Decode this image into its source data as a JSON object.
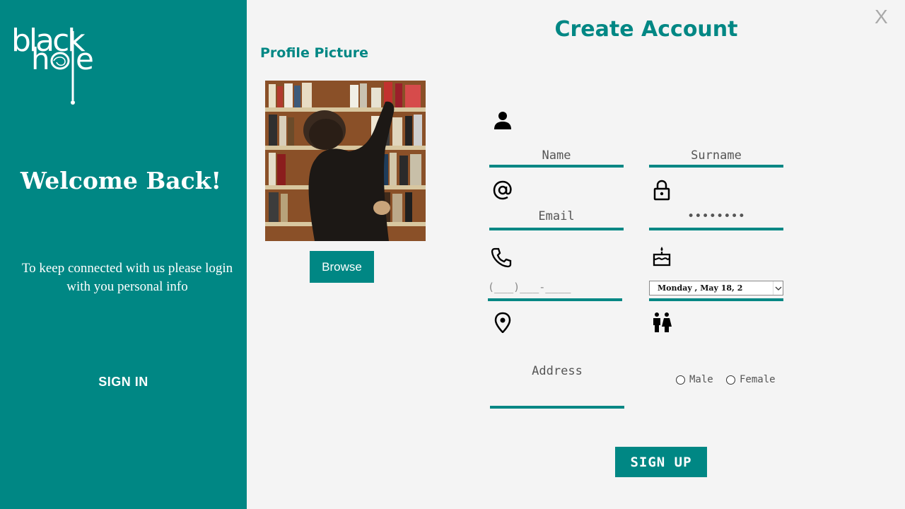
{
  "left_panel": {
    "logo_text": "black hole",
    "welcome": "Welcome Back!",
    "info": "To keep connected with us please login with you personal info",
    "signin_label": "SIGN IN",
    "background": "#008784"
  },
  "header": {
    "title": "Create Account",
    "close_label": "X"
  },
  "profile": {
    "label": "Profile Picture",
    "browse_label": "Browse"
  },
  "form": {
    "name_placeholder": "Name",
    "surname_placeholder": "Surname",
    "email_placeholder": "Email",
    "password_mask": "••••••••",
    "phone_mask": "(___)___-____",
    "birthdate": "Monday   ,    May    18, 2",
    "address_placeholder": "Address",
    "gender_options": [
      "Male",
      "Female"
    ],
    "signup_label": "SIGN UP"
  },
  "icons": {
    "name": "person-icon",
    "email": "at-sign-icon",
    "password": "lock-icon",
    "phone": "phone-icon",
    "birthdate": "birthday-cake-icon",
    "address": "map-pin-icon",
    "gender": "male-female-icon"
  },
  "colors": {
    "accent": "#008784",
    "background": "#f4f4f4",
    "close": "#a9a9a9"
  }
}
